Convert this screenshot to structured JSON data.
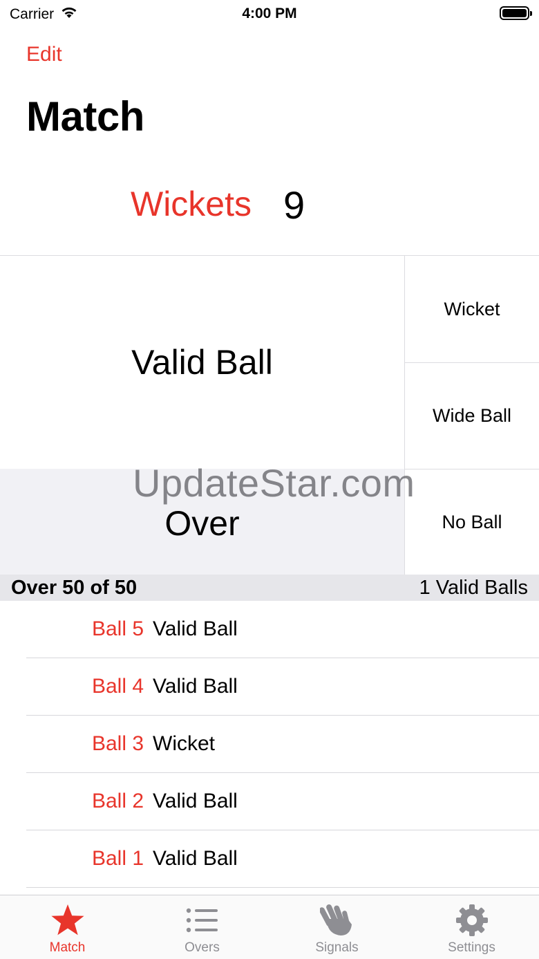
{
  "status_bar": {
    "carrier": "Carrier",
    "time": "4:00 PM"
  },
  "nav": {
    "edit_label": "Edit",
    "title": "Match"
  },
  "counter": {
    "label": "Wickets",
    "value": "9"
  },
  "buttons": {
    "valid_ball": "Valid Ball",
    "over": "Over",
    "wicket": "Wicket",
    "wide_ball": "Wide Ball",
    "no_ball": "No Ball"
  },
  "watermark": "UpdateStar.com",
  "section": {
    "over_text": "Over 50 of 50",
    "valid_balls_text": "1 Valid Balls"
  },
  "balls": [
    {
      "label": "Ball 5",
      "value": "Valid Ball"
    },
    {
      "label": "Ball 4",
      "value": "Valid Ball"
    },
    {
      "label": "Ball 3",
      "value": "Wicket"
    },
    {
      "label": "Ball 2",
      "value": "Valid Ball"
    },
    {
      "label": "Ball 1",
      "value": "Valid Ball"
    }
  ],
  "tabs": [
    {
      "label": "Match",
      "icon": "star-icon",
      "active": true
    },
    {
      "label": "Overs",
      "icon": "list-icon",
      "active": false
    },
    {
      "label": "Signals",
      "icon": "hand-wave-icon",
      "active": false
    },
    {
      "label": "Settings",
      "icon": "gear-icon",
      "active": false
    }
  ],
  "colors": {
    "accent": "#e8352b",
    "inactive_tab": "#8e8e93",
    "over_button_bg": "#f1f1f5",
    "section_bg": "#e6e6ea"
  }
}
